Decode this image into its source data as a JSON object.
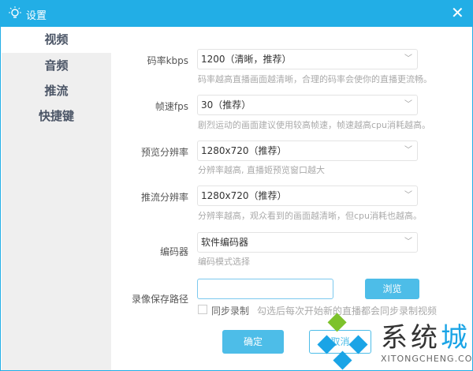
{
  "window": {
    "title": "设置",
    "accent": "#22aee6"
  },
  "sidebar": {
    "items": [
      {
        "label": "视频",
        "active": true
      },
      {
        "label": "音频"
      },
      {
        "label": "推流"
      },
      {
        "label": "快捷键"
      }
    ]
  },
  "form": {
    "bitrate": {
      "label": "码率kbps",
      "value": "1200（清晰，推荐）",
      "hint": "码率越高直播画面越清晰，合理的码率会使你的直播更流畅。"
    },
    "fps": {
      "label": "帧速fps",
      "value": "30（推荐）",
      "hint": "剧烈运动的画面建议使用较高帧速，帧速越高cpu消耗越高。"
    },
    "preview_res": {
      "label": "预览分辨率",
      "value": "1280x720（推荐）",
      "hint": "分辨率越高, 直播姬预览窗口越大"
    },
    "stream_res": {
      "label": "推流分辨率",
      "value": "1280x720（推荐）",
      "hint": "分辨率越高，观众看到的画面越清晰，但cpu消耗也越高。"
    },
    "encoder": {
      "label": "编码器",
      "value": "软件编码器",
      "hint": "编码模式选择"
    },
    "record_path": {
      "label": "录像保存路径",
      "value": "",
      "browse_label": "浏览"
    },
    "sync_record": {
      "label": "同步录制",
      "checked": false,
      "hint": "勾选后每次开始新的直播都会同步录制视频"
    }
  },
  "buttons": {
    "ok": "确定",
    "cancel": "取消"
  },
  "watermark": {
    "text": "系统城",
    "url": "XITONGCHENG.COM"
  }
}
